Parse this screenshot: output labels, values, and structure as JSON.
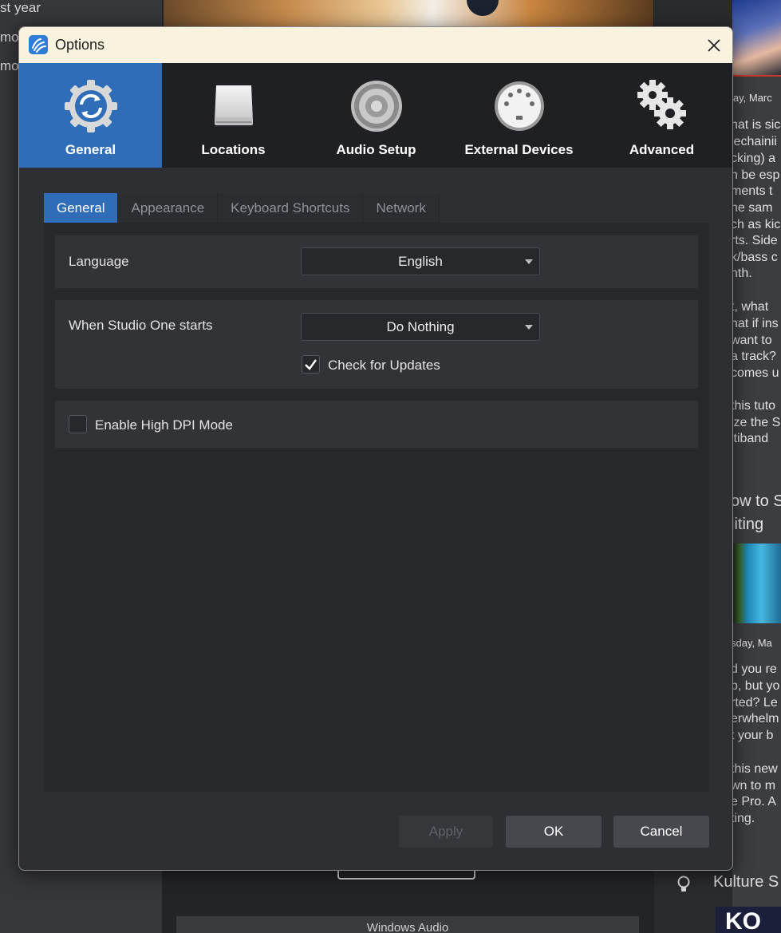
{
  "background": {
    "left_items": [
      "st year",
      "mo",
      "mo"
    ],
    "right_article": {
      "date_1": "lay, Marc",
      "paragraph_1": [
        "nat is sic",
        "lechainii",
        "cking) a",
        "n be esp",
        "ments t",
        "he sam",
        "ch as kic",
        "rts. Side",
        "k/bass c",
        "nth."
      ],
      "paragraph_2": [
        "t, what",
        "nat if ins",
        "want to",
        "a track?",
        "comes u"
      ],
      "paragraph_3": [
        "this tuto",
        "ize the S",
        "ltiband"
      ],
      "heading": [
        "ow to S",
        "liting"
      ],
      "date_2": "sday, Ma",
      "paragraph_4": [
        "d you re",
        "b, but yo",
        "rted? Le",
        "erwhelm",
        "t your b"
      ],
      "paragraph_5": [
        "this new",
        "wn to m",
        "e Pro. A",
        "ting."
      ]
    },
    "kulture": "Kulture S",
    "logo_text": "KO",
    "windows_audio": "Windows Audio"
  },
  "dialog": {
    "title": "Options",
    "close_glyph": "✕"
  },
  "categories": [
    {
      "label": "General",
      "icon": "sync-gear-icon",
      "active": true
    },
    {
      "label": "Locations",
      "icon": "drive-icon",
      "active": false
    },
    {
      "label": "Audio Setup",
      "icon": "speaker-icon",
      "active": false
    },
    {
      "label": "External Devices",
      "icon": "midi-port-icon",
      "active": false
    },
    {
      "label": "Advanced",
      "icon": "gears-icon",
      "active": false
    }
  ],
  "tabs": [
    {
      "label": "General",
      "active": true
    },
    {
      "label": "Appearance",
      "active": false
    },
    {
      "label": "Keyboard Shortcuts",
      "active": false
    },
    {
      "label": "Network",
      "active": false
    }
  ],
  "settings": {
    "language": {
      "label": "Language",
      "value": "English"
    },
    "startup": {
      "label": "When Studio One starts",
      "value": "Do Nothing"
    },
    "check_updates": {
      "label": "Check for Updates",
      "checked": true
    },
    "high_dpi": {
      "label": "Enable High DPI Mode",
      "checked": false
    }
  },
  "buttons": {
    "apply": "Apply",
    "ok": "OK",
    "cancel": "Cancel"
  },
  "colors": {
    "accent": "#2f6db9",
    "titlebar": "#f8f2df",
    "panel": "#27282b"
  }
}
